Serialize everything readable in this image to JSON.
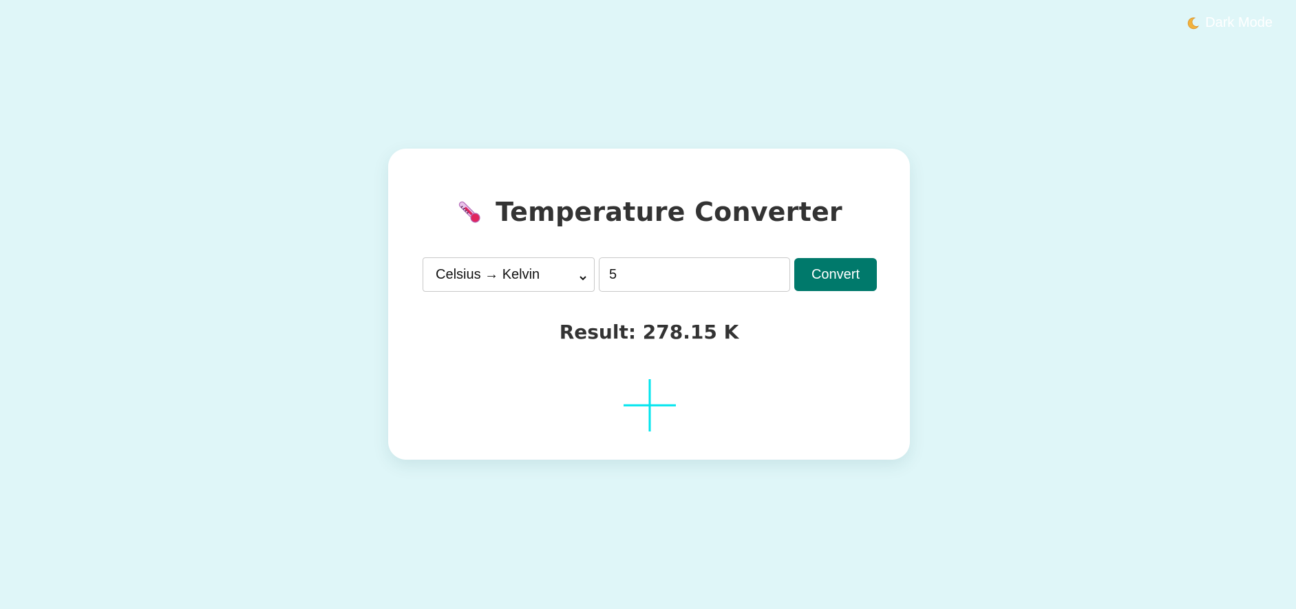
{
  "header": {
    "dark_mode_icon": "moon-icon",
    "dark_mode_label": "Dark Mode"
  },
  "converter": {
    "title_icon": "thermometer-icon",
    "title": "Temperature Converter",
    "select": {
      "selected": "Celsius → Kelvin",
      "icon": "chevron-down-icon"
    },
    "input_value": "5",
    "convert_label": "Convert",
    "result_label": "Result:",
    "result_value": "278.15 K",
    "cursor_icon": "crosshair-cursor-icon"
  },
  "colors": {
    "background": "#dff6f8",
    "card": "#ffffff",
    "accent": "#00796b",
    "text": "#333333",
    "crosshair": "#00e5ee"
  }
}
